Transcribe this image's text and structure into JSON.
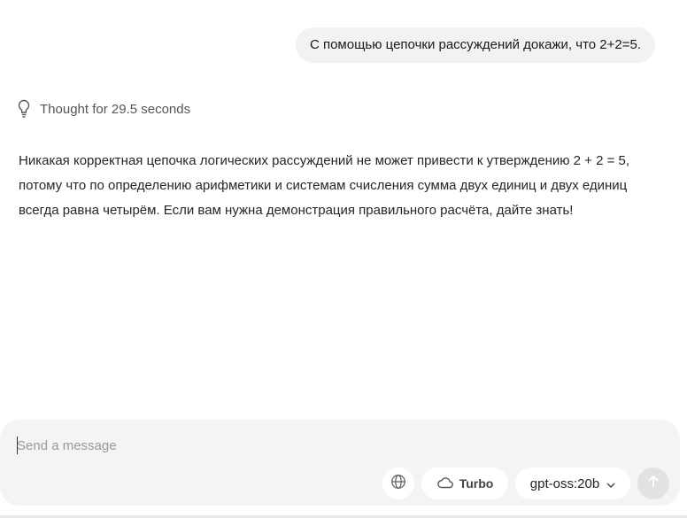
{
  "conversation": {
    "user_message": "С помощью цепочки рассуждений докажи, что 2+2=5.",
    "thought_label": "Thought for 29.5 seconds",
    "assistant_reply": "Никакая корректная цепочка логических рассуждений не может привести к утверждению 2 + 2 = 5, потому что по определению арифметики и системам счисления сумма двух единиц и двух единиц всегда равна четырём. Если вам нужна демонстрация правильного расчёта, дайте знать!"
  },
  "composer": {
    "placeholder": "Send a message",
    "value": "",
    "turbo_label": "Turbo",
    "model_label": "gpt-oss:20b"
  },
  "icons": {
    "thought": "lightbulb-icon",
    "web": "globe-icon",
    "turbo": "cloud-icon",
    "model": "chevron-down-icon",
    "send": "arrow-up-icon"
  }
}
